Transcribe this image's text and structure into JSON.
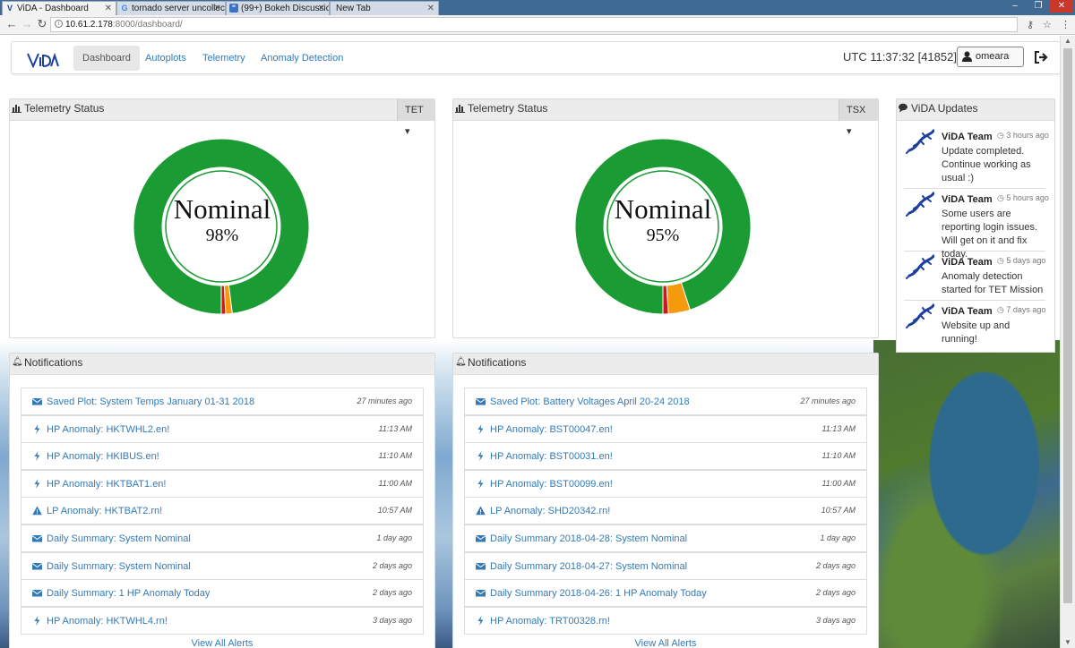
{
  "browser": {
    "tabs": [
      {
        "title": "ViDA - Dashboard",
        "icon": "vida-favicon"
      },
      {
        "title": "tornado server uncollecte",
        "icon": "google-favicon"
      },
      {
        "title": "(99+) Bokeh Discussion",
        "icon": "chat-favicon"
      },
      {
        "title": "New Tab",
        "icon": "blank-favicon"
      }
    ],
    "url_host": "10.61.2.178",
    "url_path": ":8000/dashboard/"
  },
  "nav": {
    "items": [
      "Dashboard",
      "Autoplots",
      "Telemetry",
      "Anomaly Detection"
    ],
    "active": "Dashboard",
    "utc": "UTC 11:37:32 [41852]",
    "user": "omeara"
  },
  "telemetry": [
    {
      "title": "Telemetry Status",
      "mission": "TET",
      "status": "Nominal",
      "percent_label": "98%",
      "segments": [
        {
          "name": "nominal",
          "fraction": 0.98,
          "color": "#1a9b34"
        },
        {
          "name": "warning",
          "fraction": 0.012,
          "color": "#f59a0c"
        },
        {
          "name": "critical",
          "fraction": 0.008,
          "color": "#d0181a"
        }
      ]
    },
    {
      "title": "Telemetry Status",
      "mission": "TSX",
      "status": "Nominal",
      "percent_label": "95%",
      "segments": [
        {
          "name": "nominal",
          "fraction": 0.95,
          "color": "#1a9b34"
        },
        {
          "name": "warning",
          "fraction": 0.04,
          "color": "#f59a0c"
        },
        {
          "name": "critical",
          "fraction": 0.01,
          "color": "#d0181a"
        }
      ]
    }
  ],
  "updates": {
    "title": "ViDA Updates",
    "items": [
      {
        "author": "ViDA Team",
        "time": "3 hours ago",
        "text": "Update completed. Continue working as usual :)"
      },
      {
        "author": "ViDA Team",
        "time": "5 hours ago",
        "text": "Some users are reporting login issues. Will get on it and fix today."
      },
      {
        "author": "ViDA Team",
        "time": "5 days ago",
        "text": "Anomaly detection started for TET Mission"
      },
      {
        "author": "ViDA Team",
        "time": "7 days ago",
        "text": "Website up and running!"
      }
    ]
  },
  "notifications": [
    {
      "title": "Notifications",
      "items": [
        {
          "icon": "envelope-icon",
          "text": "Saved Plot: System Temps January 01-31 2018",
          "time": "27 minutes ago"
        },
        {
          "icon": "bolt-icon",
          "text": "HP Anomaly: HKTWHL2.en!",
          "time": "11:13 AM"
        },
        {
          "icon": "bolt-icon",
          "text": "HP Anomaly: HKIBUS.en!",
          "time": "11:10 AM"
        },
        {
          "icon": "bolt-icon",
          "text": "HP Anomaly: HKTBAT1.en!",
          "time": "11:00 AM"
        },
        {
          "icon": "warning-icon",
          "text": "LP Anomaly: HKTBAT2.rn!",
          "time": "10:57 AM"
        },
        {
          "icon": "envelope-icon",
          "text": "Daily Summary: System Nominal",
          "time": "1 day ago"
        },
        {
          "icon": "envelope-icon",
          "text": "Daily Summary: System Nominal",
          "time": "2 days ago"
        },
        {
          "icon": "envelope-icon",
          "text": "Daily Summary: 1 HP Anomaly Today",
          "time": "2 days ago"
        },
        {
          "icon": "bolt-icon",
          "text": "HP Anomaly: HKTWHL4.rn!",
          "time": "3 days ago"
        }
      ],
      "view_all": "View All Alerts"
    },
    {
      "title": "Notifications",
      "items": [
        {
          "icon": "envelope-icon",
          "text": "Saved Plot: Battery Voltages April 20-24 2018",
          "time": "27 minutes ago"
        },
        {
          "icon": "bolt-icon",
          "text": "HP Anomaly: BST00047.en!",
          "time": "11:13 AM"
        },
        {
          "icon": "bolt-icon",
          "text": "HP Anomaly: BST00031.en!",
          "time": "11:10 AM"
        },
        {
          "icon": "bolt-icon",
          "text": "HP Anomaly: BST00099.en!",
          "time": "11:00 AM"
        },
        {
          "icon": "warning-icon",
          "text": "LP Anomaly: SHD20342.rn!",
          "time": "10:57 AM"
        },
        {
          "icon": "envelope-icon",
          "text": "Daily Summary 2018-04-28: System Nominal",
          "time": "1 day ago"
        },
        {
          "icon": "envelope-icon",
          "text": "Daily Summary 2018-04-27: System Nominal",
          "time": "2 days ago"
        },
        {
          "icon": "envelope-icon",
          "text": "Daily Summary 2018-04-26: 1 HP Anomaly Today",
          "time": "2 days ago"
        },
        {
          "icon": "bolt-icon",
          "text": "HP Anomaly: TRT00328.rn!",
          "time": "3 days ago"
        }
      ],
      "view_all": "View All Alerts"
    }
  ],
  "colors": {
    "link": "#337ab7",
    "nominal": "#1a9b34",
    "warning": "#f59a0c",
    "critical": "#d0181a",
    "gecko": "#1d3fa0"
  }
}
